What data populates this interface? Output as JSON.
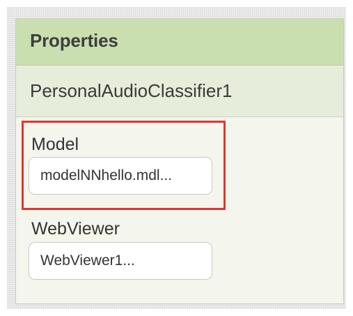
{
  "panel": {
    "title": "Properties",
    "component_name": "PersonalAudioClassifier1"
  },
  "properties": [
    {
      "label": "Model",
      "value": "modelNNhello.mdl..."
    },
    {
      "label": "WebViewer",
      "value": "WebViewer1..."
    }
  ],
  "colors": {
    "header_bg": "#cadfb0",
    "component_bar_bg": "#e7eddb",
    "panel_bg": "#f4f6ee",
    "highlight": "#e8322e"
  }
}
